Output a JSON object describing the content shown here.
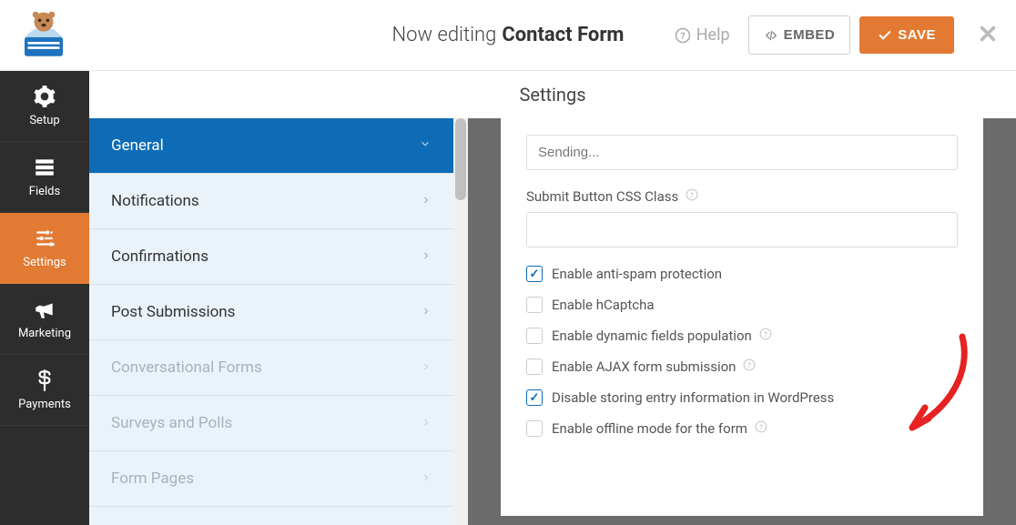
{
  "header": {
    "editing_prefix": "Now editing",
    "form_name": "Contact Form",
    "help_label": "Help",
    "embed_label": "EMBED",
    "save_label": "SAVE"
  },
  "sidenav": {
    "setup": "Setup",
    "fields": "Fields",
    "settings": "Settings",
    "marketing": "Marketing",
    "payments": "Payments"
  },
  "panel": {
    "title": "Settings",
    "items": {
      "general": "General",
      "notifications": "Notifications",
      "confirmations": "Confirmations",
      "post_submissions": "Post Submissions",
      "conversational_forms": "Conversational Forms",
      "surveys_polls": "Surveys and Polls",
      "form_pages": "Form Pages"
    }
  },
  "content": {
    "sending_value": "Sending...",
    "submit_css_label": "Submit Button CSS Class",
    "checks": {
      "antispam": "Enable anti-spam protection",
      "hcaptcha": "Enable hCaptcha",
      "dynamic": "Enable dynamic fields population",
      "ajax": "Enable AJAX form submission",
      "disable_store": "Disable storing entry information in WordPress",
      "offline": "Enable offline mode for the form"
    }
  }
}
